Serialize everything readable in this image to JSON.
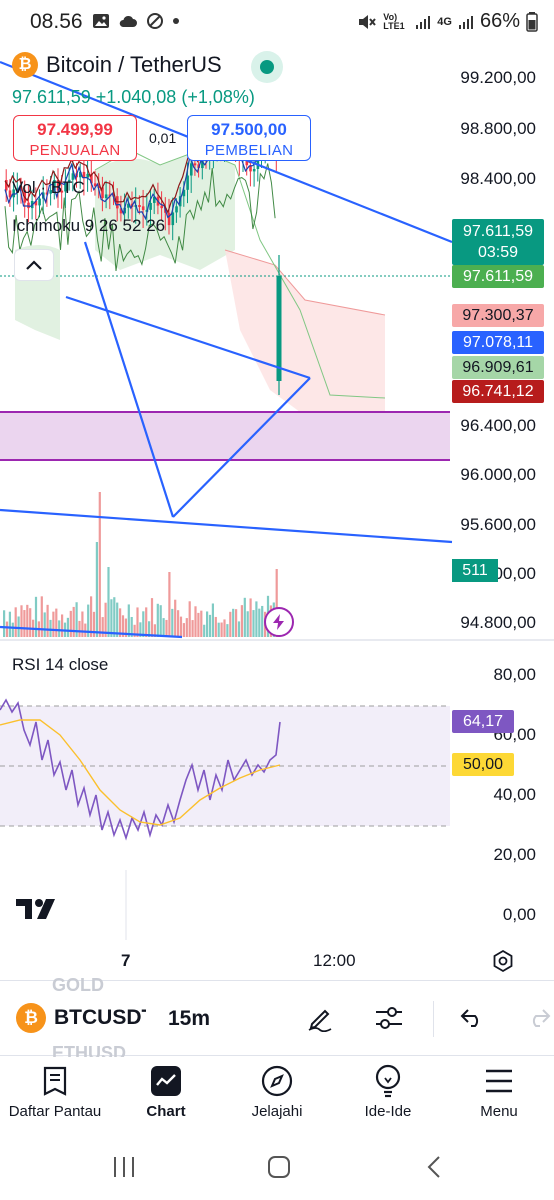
{
  "status_bar": {
    "time": "08.56",
    "network": "Vo) LTE1",
    "network_type": "4G",
    "battery": "66%",
    "icons": [
      "gallery-icon",
      "cloud-icon",
      "blocked-icon",
      "dot-icon",
      "mute-icon",
      "signal-icon",
      "battery-icon"
    ]
  },
  "chart_header": {
    "symbol_name": "Bitcoin / TetherUS",
    "price_change": "97.611,59  +1.040,08 (+1,08%)",
    "sell_price": "97.499,99",
    "sell_label": "PENJUALAN",
    "buy_price": "97.500,00",
    "buy_label": "PEMBELIAN",
    "spread": "0,01",
    "vol_label": "Vol · BTC",
    "ichimoku_label": "Ichimoku 9 26 52 26"
  },
  "price_axis": [
    "99.200,00",
    "98.800,00",
    "98.400,00",
    "96.400,00",
    "96.000,00",
    "95.600,00",
    "95.200,00",
    "94.800,00"
  ],
  "price_tags": {
    "last_price": "97.611,59",
    "countdown": "03:59",
    "last_price_2": "97.611,59",
    "tag_pink": "97.300,37",
    "tag_blue": "97.078,11",
    "tag_lightgreen": "96.909,61",
    "tag_red": "96.741,12",
    "volume": "511"
  },
  "rsi": {
    "title": "RSI 14 close",
    "axis": [
      "80,00",
      "60,00",
      "40,00",
      "20,00",
      "0,00"
    ],
    "value_tag": "64,17",
    "ma_tag": "50,00"
  },
  "time_axis": [
    "7",
    "12:00"
  ],
  "toolbar": {
    "ghost_top": "GOLD",
    "ghost_bottom": "ETHUSD",
    "symbol": "BTCUSDT",
    "interval": "15m"
  },
  "bottom_nav": [
    {
      "label": "Daftar Pantau",
      "icon": "watchlist-icon"
    },
    {
      "label": "Chart",
      "icon": "chart-icon"
    },
    {
      "label": "Jelajahi",
      "icon": "compass-icon"
    },
    {
      "label": "Ide-Ide",
      "icon": "lightbulb-icon"
    },
    {
      "label": "Menu",
      "icon": "menu-icon"
    }
  ],
  "colors": {
    "up": "#089981",
    "down": "#f23645",
    "accent": "#2962ff",
    "rsi_line": "#7e57c2",
    "rsi_ma": "#fbc02d",
    "zone": "#9c27b0"
  }
}
